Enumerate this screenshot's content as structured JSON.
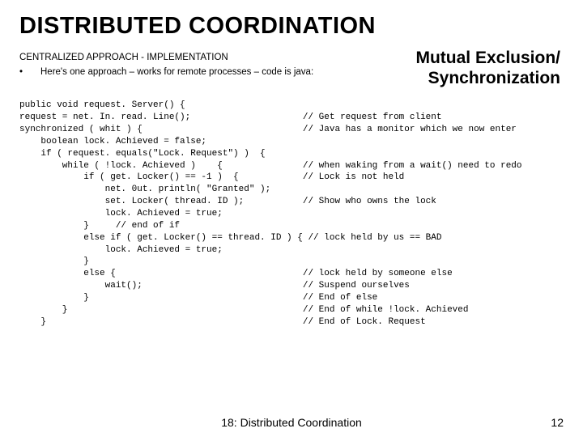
{
  "title": "DISTRIBUTED COORDINATION",
  "subtitle": "CENTRALIZED APPROACH - IMPLEMENTATION",
  "topic_line1": "Mutual Exclusion/",
  "topic_line2": "Synchronization",
  "bullet_char": "•",
  "bullet_text": "Here's one approach – works for remote processes – code is java:",
  "code": "public void request. Server() {\nrequest = net. In. read. Line();                     // Get request from client\nsynchronized ( whit ) {                              // Java has a monitor which we now enter\n    boolean lock. Achieved = false;\n    if ( request. equals(\"Lock. Request\") )  {\n        while ( !lock. Achieved )    {               // when waking from a wait() need to redo\n            if ( get. Locker() == -1 )  {            // Lock is not held\n                net. 0ut. println( \"Granted\" );\n                set. Locker( thread. ID );           // Show who owns the lock\n                lock. Achieved = true;\n            }     // end of if\n            else if ( get. Locker() == thread. ID ) { // lock held by us == BAD\n                lock. Achieved = true;\n            }\n            else {                                   // lock held by someone else\n                wait();                              // Suspend ourselves\n            }                                        // End of else\n        }                                            // End of while !lock. Achieved\n    }                                                // End of Lock. Request",
  "footer_center": "18: Distributed Coordination",
  "footer_right": "12"
}
